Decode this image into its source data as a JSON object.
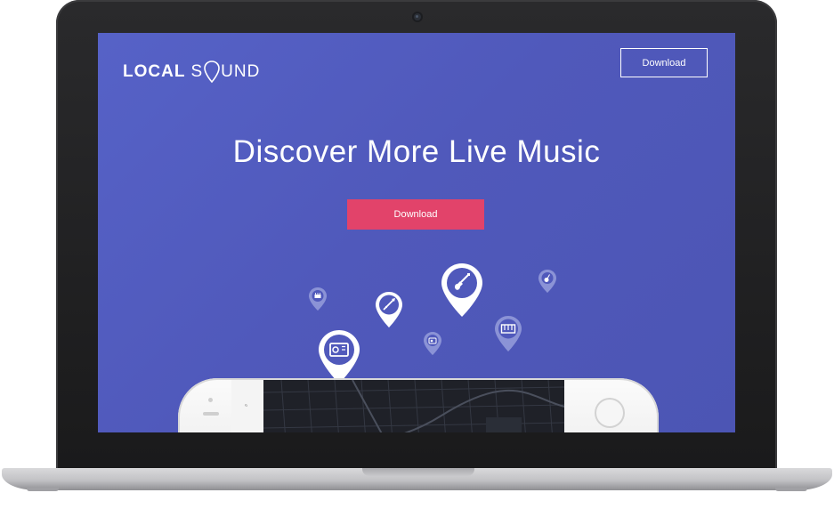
{
  "brand": {
    "name_bold": "LOCAL",
    "name_light_start": "S",
    "name_light_end": "UND"
  },
  "nav": {
    "download_label": "Download"
  },
  "hero": {
    "title": "Discover More Live Music",
    "cta_label": "Download"
  },
  "pins": [
    {
      "name": "drums-pin",
      "icon": "drum-icon"
    },
    {
      "name": "trumpet-pin",
      "icon": "trumpet-icon"
    },
    {
      "name": "guitar-pin",
      "icon": "guitar-icon"
    },
    {
      "name": "amp-pin",
      "icon": "amplifier-icon"
    },
    {
      "name": "radio-pin",
      "icon": "radio-icon"
    },
    {
      "name": "keyboard-pin",
      "icon": "keyboard-icon"
    },
    {
      "name": "bass-pin",
      "icon": "bass-icon"
    }
  ],
  "colors": {
    "background": "#5059bb",
    "cta": "#e2436a",
    "text": "#ffffff"
  }
}
